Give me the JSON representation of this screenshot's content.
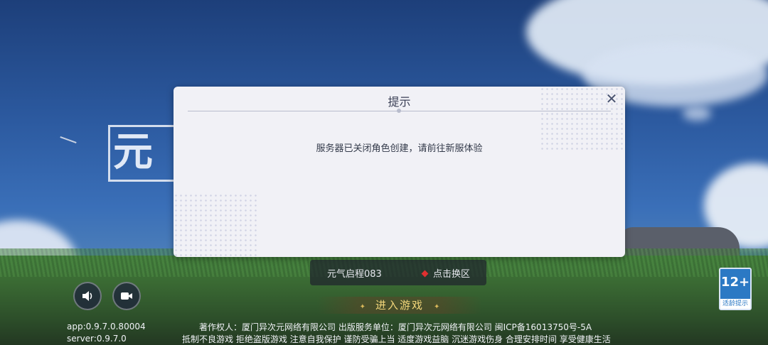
{
  "game": {
    "logo_text": "元气"
  },
  "dialog": {
    "title": "提示",
    "message": "服务器已关闭角色创建，请前往新服体验",
    "close_glyph": "✕"
  },
  "server_selector": {
    "server_name": "元气启程083",
    "switch_label": "点击换区"
  },
  "actions": {
    "enter_game_label": "进入游戏",
    "ornament_glyph": "✦"
  },
  "age_rating": {
    "rating": "12+",
    "label": "适龄提示"
  },
  "footer": {
    "app_version": "app:0.9.7.0.80004",
    "server_version": "server:0.9.7.0",
    "copyright_line": "著作权人：厦门异次元网络有限公司 出版服务单位：厦门异次元网络有限公司 闽ICP备16013750号-5A",
    "health_notice": "抵制不良游戏 拒绝盗版游戏 注意自我保护 谨防受骗上当 适度游戏益脑 沉迷游戏伤身 合理安排时间 享受健康生活"
  },
  "icons": {
    "speaker": "speaker-icon",
    "video": "video-camera-icon",
    "close": "close-icon"
  },
  "colors": {
    "dialog_bg": "#f1f1f6",
    "accent_gold": "#f2d67a",
    "age_blue": "#2b79c4",
    "switch_dot": "#e03030"
  }
}
